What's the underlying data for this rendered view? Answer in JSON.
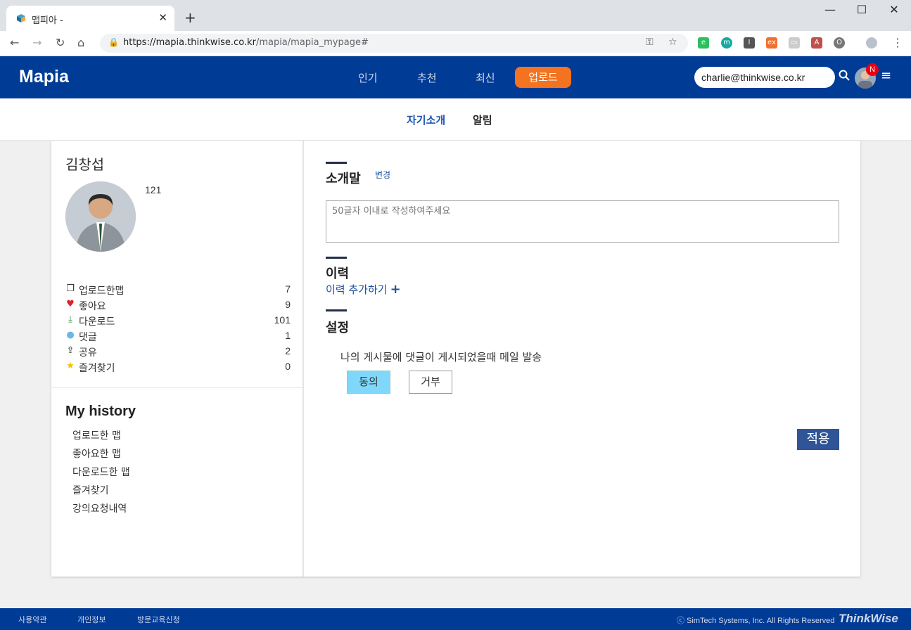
{
  "browser": {
    "tab_title": "맵피아 -",
    "new_tab": "+",
    "close_tab": "✕",
    "url_host": "https://mapia.thinkwise.co.kr",
    "url_path": "/mapia/mapia_mypage#"
  },
  "header": {
    "logo": "Mapia",
    "nav": [
      "인기",
      "추천",
      "최신"
    ],
    "upload": "업로드",
    "email": "charlie@thinkwise.co.kr",
    "badge": "N"
  },
  "subnav": {
    "about": "자기소개",
    "notice": "알림"
  },
  "profile": {
    "name": "김창섭",
    "score": "121",
    "stats": [
      {
        "icon": "copy-icon",
        "label": "업로드한맵",
        "value": "7"
      },
      {
        "icon": "heart-icon",
        "label": "좋아요",
        "value": "9"
      },
      {
        "icon": "download-icon",
        "label": "다운로드",
        "value": "101"
      },
      {
        "icon": "comment-icon",
        "label": "댓글",
        "value": "1"
      },
      {
        "icon": "share-icon",
        "label": "공유",
        "value": "2"
      },
      {
        "icon": "star-icon",
        "label": "즐겨찾기",
        "value": "0"
      }
    ]
  },
  "history": {
    "title": "My history",
    "items": [
      "업로드한 맵",
      "좋아요한 맵",
      "다운로드한 맵",
      "즐겨찾기",
      "강의요청내역"
    ]
  },
  "main": {
    "intro_title": "소개말",
    "intro_change": "변경",
    "intro_placeholder": "50글자 이내로 작성하여주세요",
    "career_title": "이력",
    "career_add": "이력 추가하기",
    "settings_title": "설정",
    "mail_text": "나의 게시물에 댓글이 게시되었을때 메일 발송",
    "agree": "동의",
    "refuse": "거부",
    "apply": "적용"
  },
  "footer": {
    "links": [
      "사용약관",
      "개인정보",
      "방문교육신청"
    ],
    "copyright": "ⓒ SimTech Systems, Inc. All Rights Reserved",
    "brand": "ThinkWise"
  },
  "colors": {
    "brand": "#003b96",
    "upload": "#f37321",
    "agree": "#7fd8fc",
    "apply": "#2f5597"
  }
}
